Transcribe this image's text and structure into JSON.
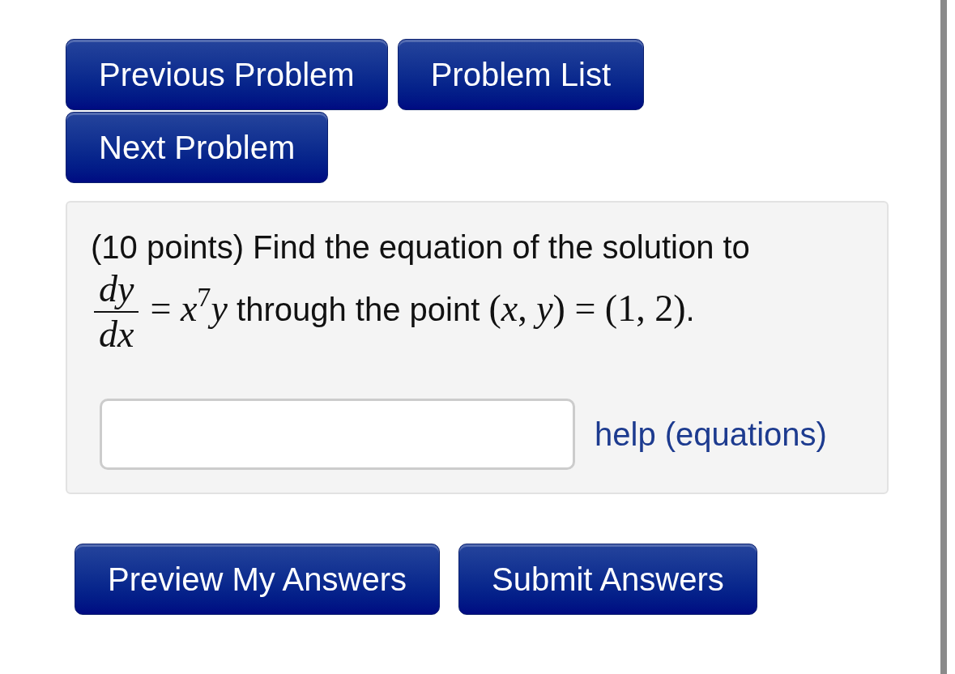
{
  "nav_buttons": [
    {
      "label": "Previous Problem"
    },
    {
      "label": "Problem List"
    },
    {
      "label": "Next Problem"
    }
  ],
  "problem": {
    "statement": [
      {
        "kind": "text",
        "text": "(10 points) Find the equation of the solution to "
      },
      {
        "kind": "math",
        "fraction": {
          "numerator": "dy",
          "denominator": "dx"
        },
        "text": "= *x*$^{7}$*y*"
      },
      {
        "kind": "text",
        "text": " through the point "
      },
      {
        "kind": "math",
        "text": "(*x*, *y*) = (1, 2)"
      },
      {
        "kind": "text",
        "text": "."
      }
    ],
    "help_link": "help (equations)"
  },
  "form_buttons": [
    {
      "label": "Preview My Answers"
    },
    {
      "label": "Submit Answers"
    }
  ]
}
